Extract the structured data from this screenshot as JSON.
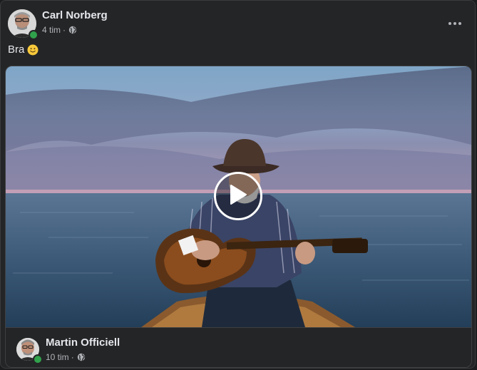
{
  "post": {
    "author": "Carl Norberg",
    "time": "4 tim",
    "separator": "·",
    "audience_icon": "globe-icon",
    "text": "Bra",
    "emoji": "slightly-smiling-face",
    "more_icon": "more-horizontal-icon"
  },
  "shared": {
    "author": "Martin Officiell",
    "time": "10 tim",
    "separator": "·",
    "audience_icon": "globe-icon",
    "media_type": "video",
    "play_icon": "play-icon"
  },
  "colors": {
    "background": "#242526",
    "text_primary": "#e4e6eb",
    "text_secondary": "#b0b3b8",
    "online": "#31a24c"
  }
}
